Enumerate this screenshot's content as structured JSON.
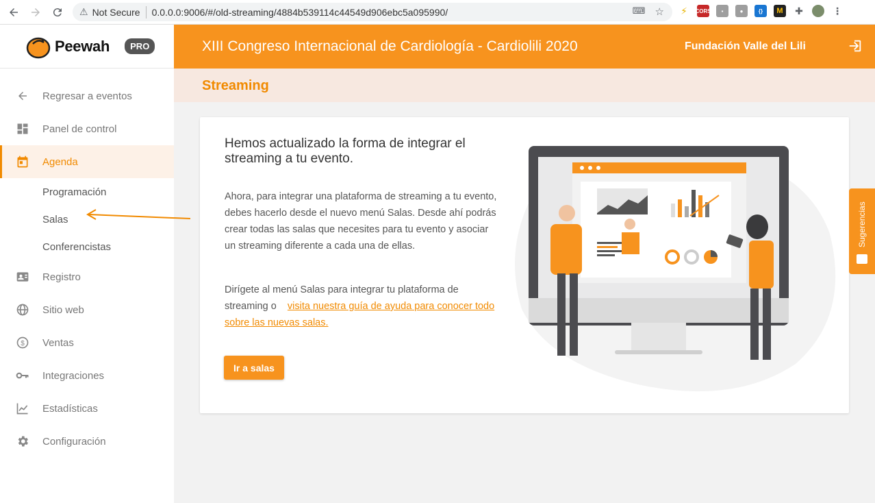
{
  "browser": {
    "security": "Not Secure",
    "url": "0.0.0.0:9006/#/old-streaming/4884b539114c44549d906ebc5a095990/"
  },
  "sidebar": {
    "brand": "Peewah",
    "badge": "PRO",
    "items": [
      {
        "label": "Regresar a eventos",
        "icon": "arrow-left-icon"
      },
      {
        "label": "Panel de control",
        "icon": "dashboard-icon"
      },
      {
        "label": "Agenda",
        "icon": "calendar-icon"
      },
      {
        "label": "Registro",
        "icon": "id-card-icon"
      },
      {
        "label": "Sitio web",
        "icon": "globe-icon"
      },
      {
        "label": "Ventas",
        "icon": "dollar-icon"
      },
      {
        "label": "Integraciones",
        "icon": "key-icon"
      },
      {
        "label": "Estadísticas",
        "icon": "chart-line-icon"
      },
      {
        "label": "Configuración",
        "icon": "gear-icon"
      }
    ],
    "agenda_sub": [
      "Programación",
      "Salas",
      "Conferencistas"
    ]
  },
  "header": {
    "event_title": "XIII Congreso Internacional de Cardiología - Cardiolili 2020",
    "org_name": "Fundación Valle del Lili"
  },
  "section": {
    "title": "Streaming"
  },
  "card": {
    "title": "Hemos actualizado la forma de integrar el streaming a tu evento.",
    "p1": "Ahora, para integrar una plataforma de streaming a tu evento, debes hacerlo desde el nuevo menú Salas. Desde ahí podrás crear todas las salas que necesites para tu evento y asociar un streaming diferente a cada una de ellas.",
    "p2_prefix": "Dirígete al menú Salas para integrar tu plataforma de streaming o",
    "p2_link": "visita nuestra guía de ayuda para conocer todo sobre las nuevas salas.",
    "button": "Ir a salas"
  },
  "feedback_tab": {
    "label": "Sugerencias"
  },
  "colors": {
    "accent": "#f7931e",
    "accent_text": "#f18a00",
    "subheader_bg": "#f7e8e0"
  }
}
